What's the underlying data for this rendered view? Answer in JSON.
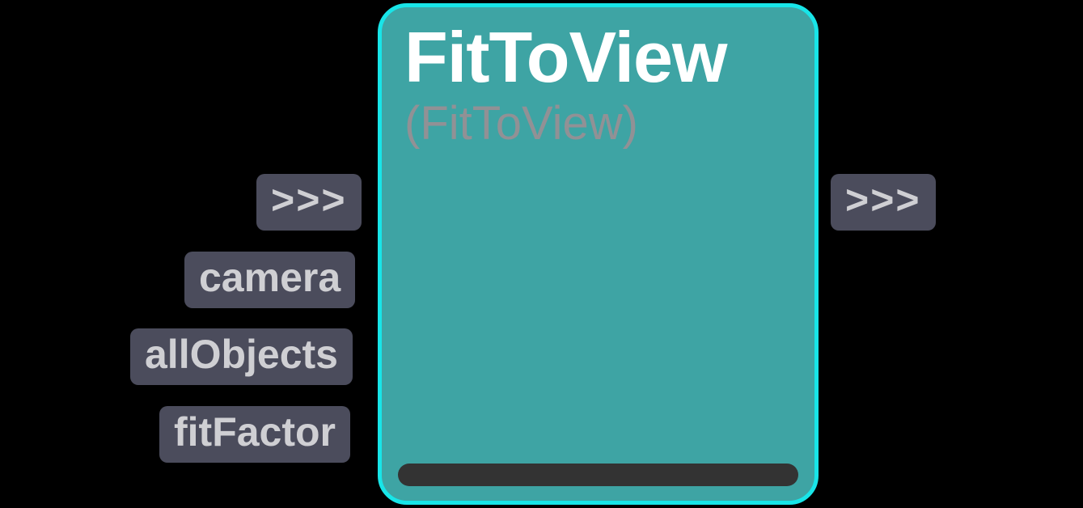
{
  "node": {
    "title": "FitToView",
    "subtitle": "(FitToView)"
  },
  "inputs": {
    "exec": ">>>",
    "items": [
      "camera",
      "allObjects",
      "fitFactor"
    ]
  },
  "outputs": {
    "exec": ">>>"
  }
}
